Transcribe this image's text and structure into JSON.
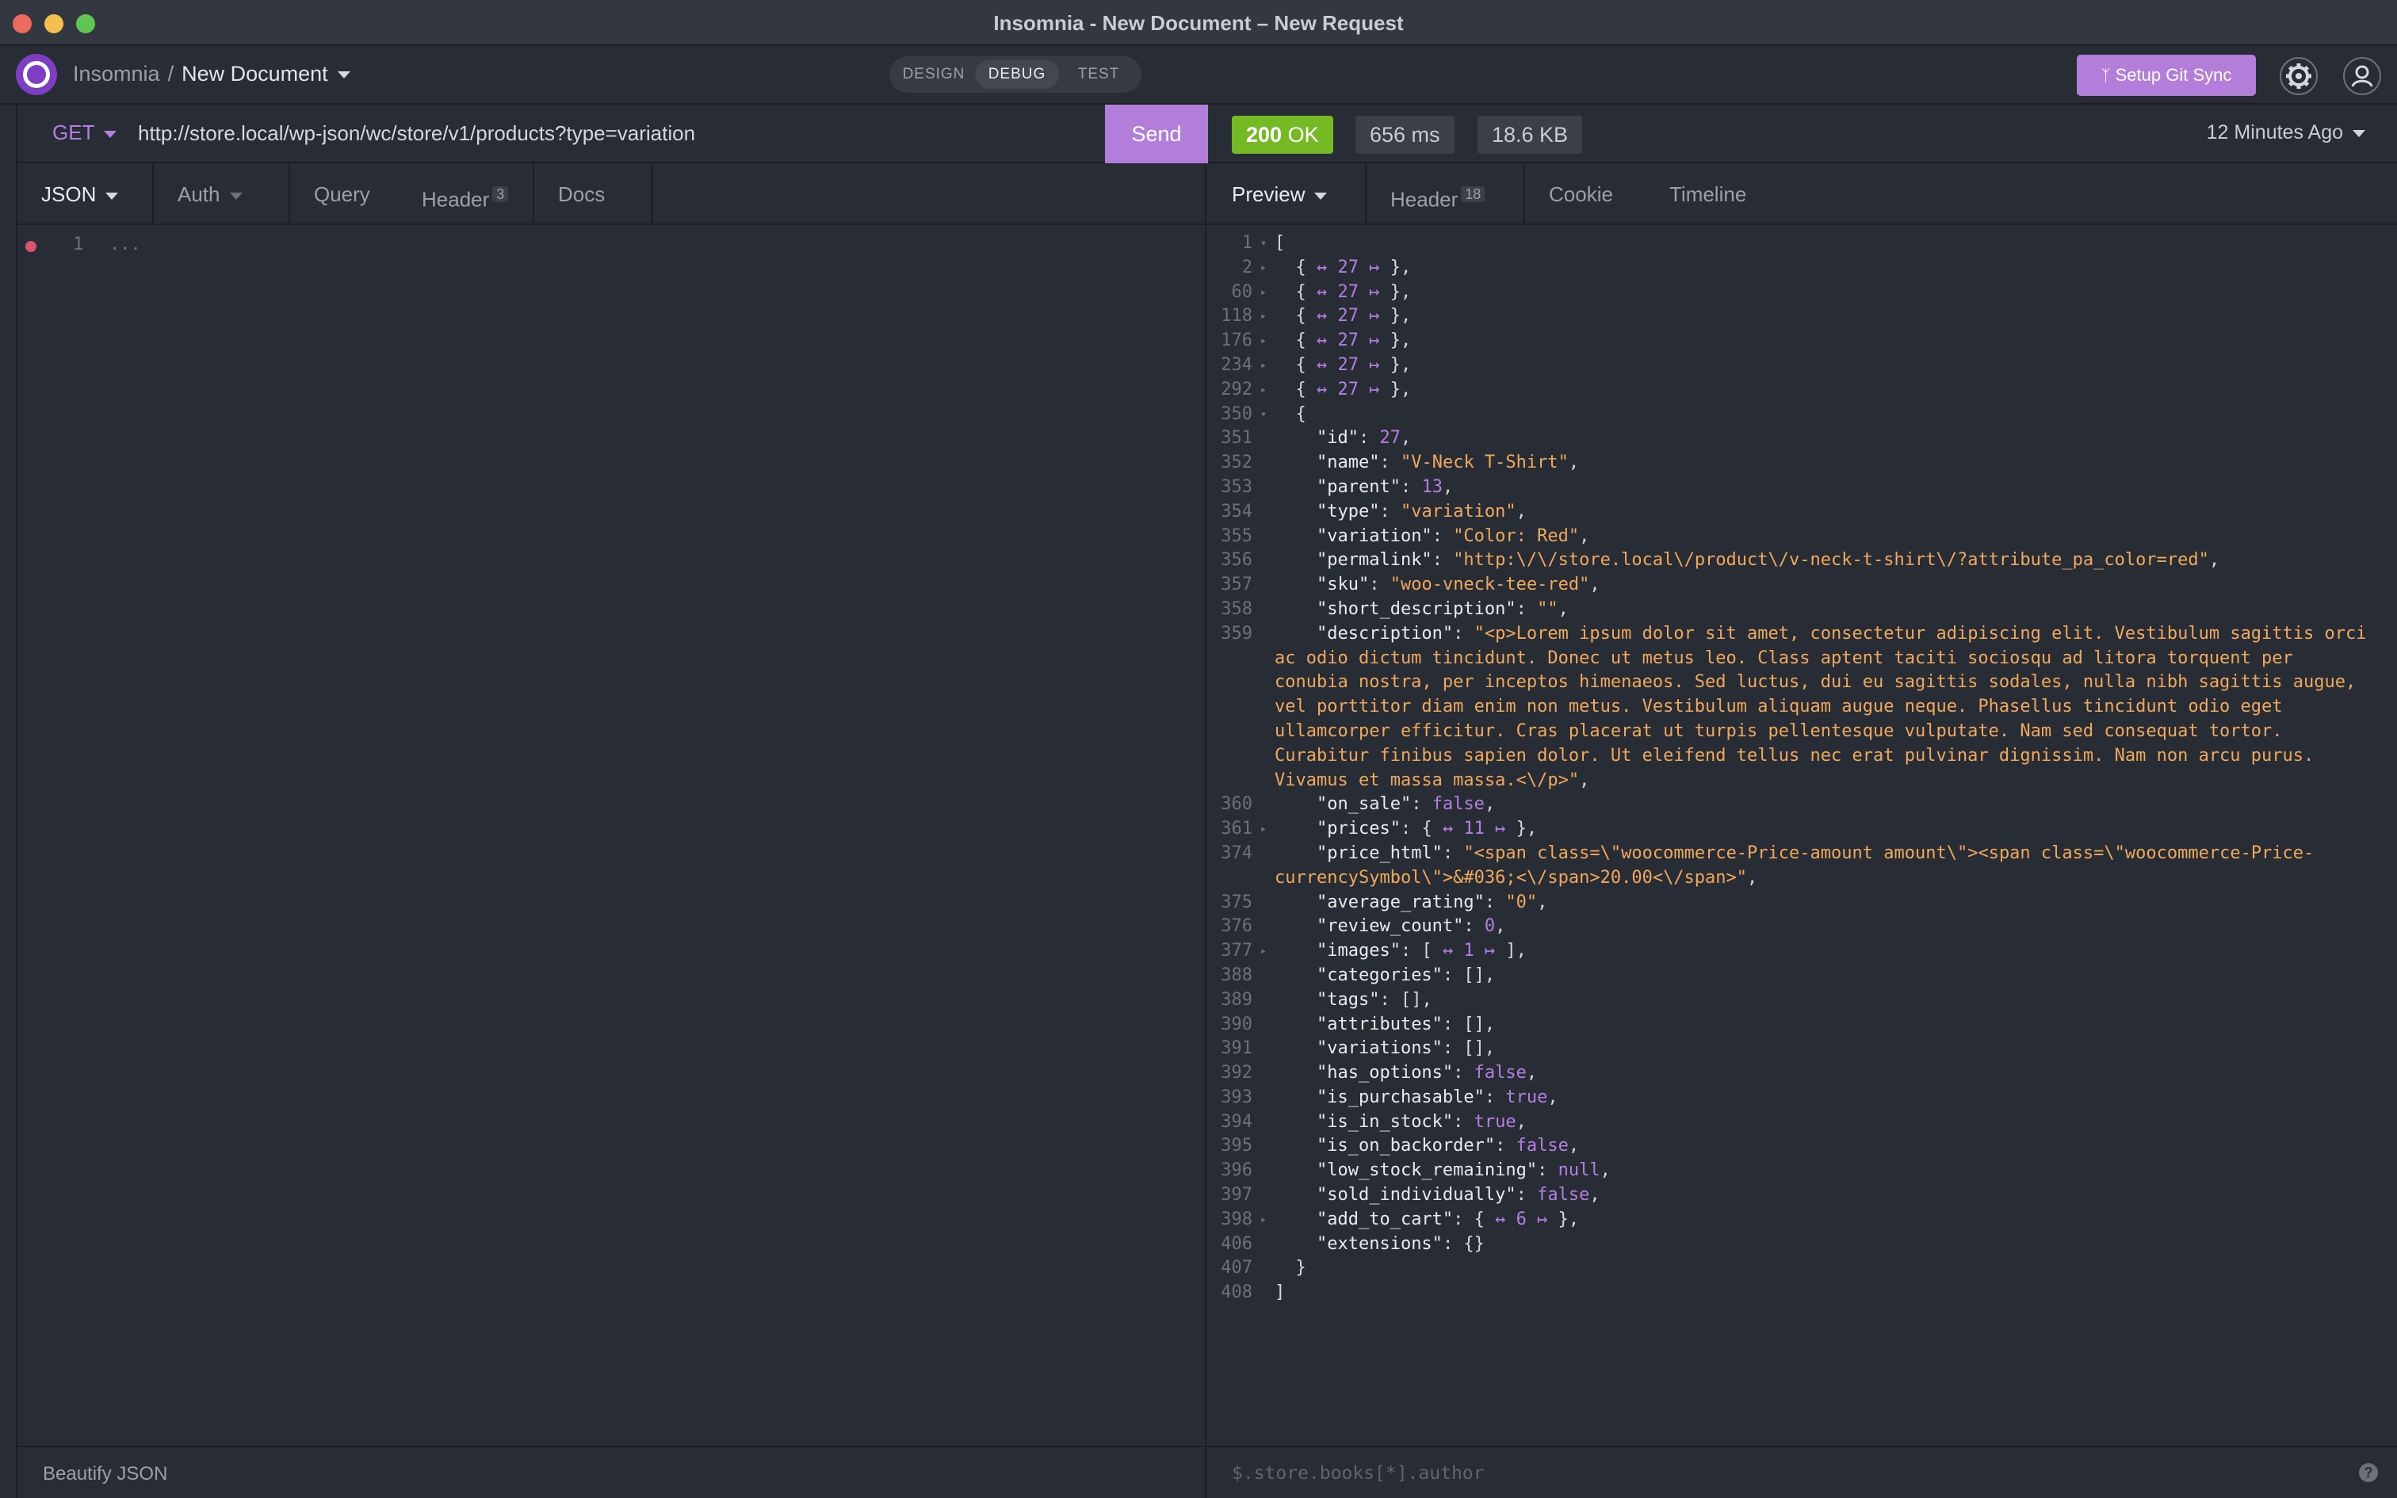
{
  "window": {
    "title": "Insomnia - New Document – New Request"
  },
  "header": {
    "breadcrumb_app": "Insomnia",
    "breadcrumb_sep": "/",
    "breadcrumb_doc": "New Document",
    "modes": [
      "DESIGN",
      "DEBUG",
      "TEST"
    ],
    "git_sync_label": "Setup Git Sync",
    "git_sync_icon": "branch-icon"
  },
  "request": {
    "method": "GET",
    "url": "http://store.local/wp-json/wc/store/v1/products?type=variation",
    "send_label": "Send",
    "tabs": [
      {
        "label": "JSON"
      },
      {
        "label": "Auth"
      },
      {
        "label": "Query"
      },
      {
        "label": "Header",
        "badge": "3"
      },
      {
        "label": "Docs"
      }
    ],
    "editor_line": "1",
    "editor_text": "...",
    "footer_label": "Beautify JSON"
  },
  "response": {
    "status": "200",
    "status_text": "OK",
    "time": "656 ms",
    "size": "18.6 KB",
    "ago": "12 Minutes Ago",
    "tabs": [
      {
        "label": "Preview"
      },
      {
        "label": "Header",
        "badge": "18"
      },
      {
        "label": "Cookie"
      },
      {
        "label": "Timeline"
      }
    ],
    "filter_placeholder": "$.store.books[*].author",
    "help": "?"
  },
  "colors": {
    "accent": "#b27ed9",
    "status_ok": "#75ba24",
    "string": "#f0a95c",
    "number": "#b37fe3"
  }
}
